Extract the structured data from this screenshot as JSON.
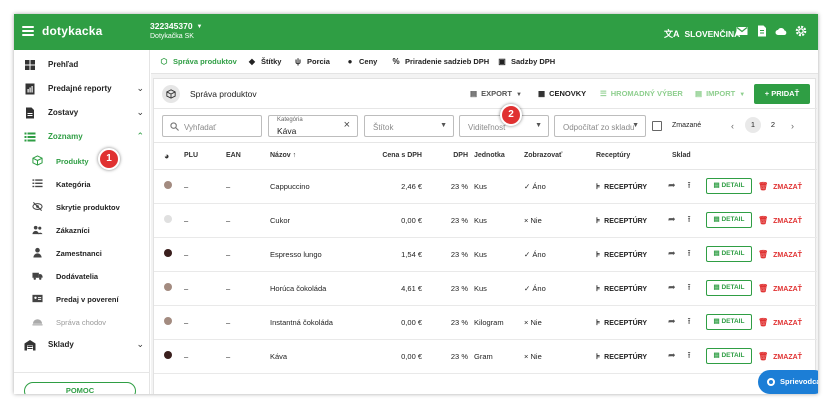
{
  "app": {
    "logo": "dotykacka",
    "account_number": "322345370",
    "account_name": "Dotykačka SK",
    "language": "SLOVENČINA"
  },
  "sidebar": {
    "items": [
      {
        "label": "Prehľad"
      },
      {
        "label": "Predajné reporty"
      },
      {
        "label": "Zostavy"
      },
      {
        "label": "Zoznamy"
      }
    ],
    "sub_items": [
      {
        "label": "Produkty"
      },
      {
        "label": "Kategória"
      },
      {
        "label": "Skrytie produktov"
      },
      {
        "label": "Zákazníci"
      },
      {
        "label": "Zamestnanci"
      },
      {
        "label": "Dodávatelia"
      },
      {
        "label": "Predaj v poverení"
      },
      {
        "label": "Správa chodov"
      }
    ],
    "stock": {
      "label": "Sklady"
    },
    "help_label": "POMOC"
  },
  "tabs": [
    {
      "label": "Správa produktov"
    },
    {
      "label": "Štítky"
    },
    {
      "label": "Porcia"
    },
    {
      "label": "Ceny"
    },
    {
      "label": "Priradenie sadzieb DPH"
    },
    {
      "label": "Sadzby DPH"
    }
  ],
  "card": {
    "title": "Správa produktov",
    "export_label": "EXPORT",
    "labels_label": "CENOVKY",
    "bulk_label": "HROMADNÝ VÝBER",
    "import_label": "IMPORT",
    "add_label": "PRIDAŤ"
  },
  "filters": {
    "search_placeholder": "Vyhľadať",
    "category_label": "Kategória",
    "category_value": "Káva",
    "tag_placeholder": "Štítok",
    "visibility_placeholder": "Viditeľnosť",
    "stock_deduct_placeholder": "Odpočítať zo skladu",
    "deleted_label": "Zmazané",
    "pages": [
      "1",
      "2"
    ]
  },
  "table": {
    "headers": {
      "plu": "PLU",
      "ean": "EAN",
      "name": "Názov",
      "price": "Cena s DPH",
      "vat": "DPH",
      "unit": "Jednotka",
      "show": "Zobrazovať",
      "recipes": "Receptúry",
      "stock": "Sklad"
    },
    "sort_arrow": "↑",
    "recipes_label": "RECEPTÚRY",
    "detail_label": "DETAIL",
    "delete_label": "ZMAZAŤ",
    "rows": [
      {
        "color": "#a38b80",
        "plu": "–",
        "ean": "–",
        "name": "Cappuccino",
        "price": "2,46 €",
        "vat": "23 %",
        "unit": "Kus",
        "show": "Áno",
        "show_on": true
      },
      {
        "color": "#e0e0e0",
        "plu": "–",
        "ean": "–",
        "name": "Cukor",
        "price": "0,00 €",
        "vat": "23 %",
        "unit": "Kus",
        "show": "Nie",
        "show_on": false
      },
      {
        "color": "#3a1f1d",
        "plu": "–",
        "ean": "–",
        "name": "Espresso lungo",
        "price": "1,54 €",
        "vat": "23 %",
        "unit": "Kus",
        "show": "Áno",
        "show_on": true
      },
      {
        "color": "#a38b80",
        "plu": "–",
        "ean": "–",
        "name": "Horúca čokoláda",
        "price": "4,61 €",
        "vat": "23 %",
        "unit": "Kus",
        "show": "Áno",
        "show_on": true
      },
      {
        "color": "#a38b80",
        "plu": "–",
        "ean": "–",
        "name": "Instantná čokoláda",
        "price": "0,00 €",
        "vat": "23 %",
        "unit": "Kilogram",
        "show": "Nie",
        "show_on": false
      },
      {
        "color": "#3a1f1d",
        "plu": "–",
        "ean": "–",
        "name": "Káva",
        "price": "0,00 €",
        "vat": "23 %",
        "unit": "Gram",
        "show": "Nie",
        "show_on": false
      }
    ]
  },
  "guide": {
    "label": "Sprievodca",
    "badge": "1"
  },
  "markers": [
    "1",
    "2"
  ],
  "colors": {
    "brand": "#2f9e44",
    "danger": "#e03131",
    "guide": "#1c7ed6"
  }
}
